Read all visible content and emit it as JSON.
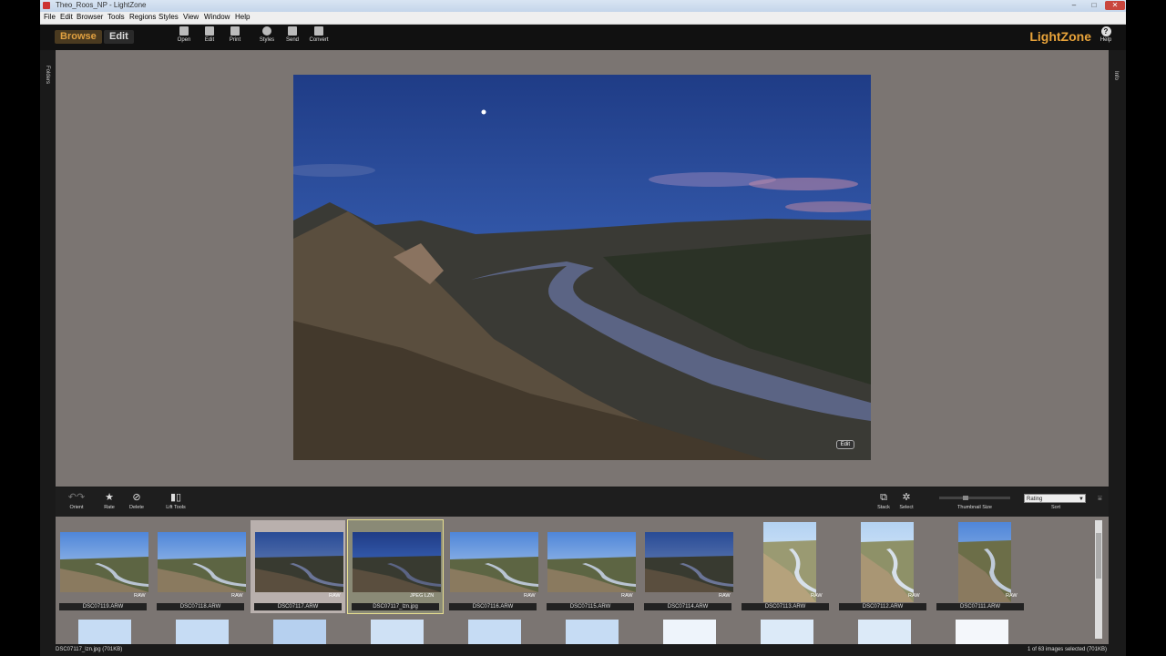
{
  "window": {
    "title": "Theo_Roos_NP - LightZone",
    "minimize": "–",
    "maximize": "□",
    "close": "✕"
  },
  "menu": [
    "File",
    "Edit",
    "Browser",
    "Tools",
    "Regions",
    "Styles",
    "View",
    "Window",
    "Help"
  ],
  "toolbar": {
    "browse_label": "Browse",
    "edit_label": "Edit",
    "buttons": [
      "Open",
      "Edit",
      "Print",
      "Styles",
      "Send",
      "Convert"
    ],
    "logo": "LightZone",
    "help_label": "Help"
  },
  "side": {
    "folders": "Folders",
    "info": "Info"
  },
  "preview": {
    "edit_badge": "Edit"
  },
  "bottom_toolbar": {
    "orient": "Orient",
    "rate": "Rate",
    "delete": "Delete",
    "lift_tools": "Lift Tools",
    "stack": "Stack",
    "select": "Select",
    "thumbnail_size": "Thumbnail Size",
    "sort_value": "Rating",
    "sort_label": "Sort"
  },
  "thumbnails": [
    {
      "name": "DSC07119.ARW",
      "badge": "RAW"
    },
    {
      "name": "DSC07118.ARW",
      "badge": "RAW"
    },
    {
      "name": "DSC07117.ARW",
      "badge": "RAW"
    },
    {
      "name": "DSC07117_lzn.jpg",
      "badge": "JPEG LZN"
    },
    {
      "name": "DSC07116.ARW",
      "badge": "RAW"
    },
    {
      "name": "DSC07115.ARW",
      "badge": "RAW"
    },
    {
      "name": "DSC07114.ARW",
      "badge": "RAW"
    },
    {
      "name": "DSC07113.ARW",
      "badge": "RAW"
    },
    {
      "name": "DSC07112.ARW",
      "badge": "RAW"
    },
    {
      "name": "DSC07111.ARW",
      "badge": "RAW"
    }
  ],
  "status": {
    "left": "DSC07117_lzn.jpg (701KB)",
    "right": "1 of 63 images selected (701KB)"
  },
  "colors": {
    "accent": "#e8a33a",
    "panel": "#7b7572"
  }
}
